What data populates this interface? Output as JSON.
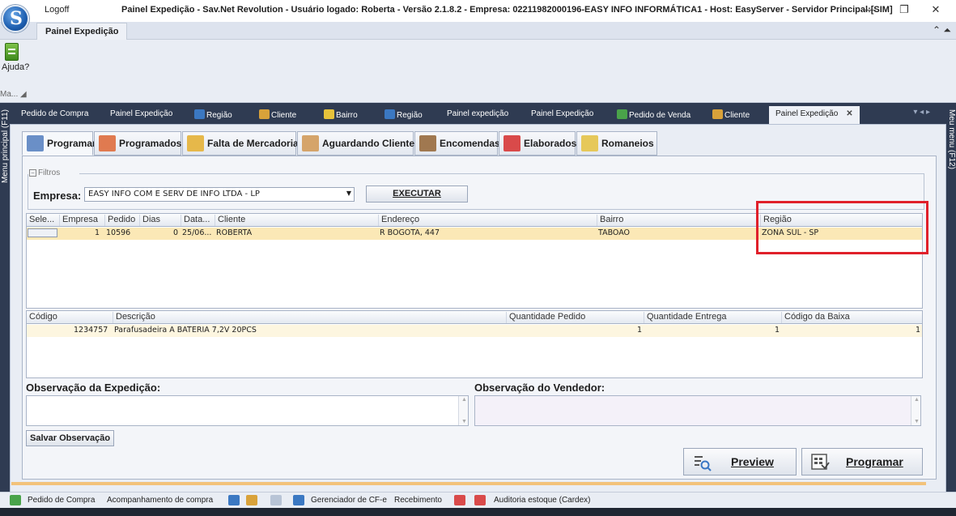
{
  "window": {
    "logoff": "Logoff",
    "title": "Painel Expedição - Sav.Net Revolution - Usuário logado: Roberta - Versão 2.1.8.2 - Empresa: 02211982000196-EASY INFO INFORMÁTICA1 - Host: EasyServer - Servidor Principal:[SIM]",
    "minimize": "—",
    "maximize": "❐",
    "close": "✕"
  },
  "ribbon": {
    "tab": "Painel Expedição",
    "right_icons": "⌃ ⏶",
    "help_label": "Ajuda?",
    "group_label": "Ma... ◢"
  },
  "side": {
    "left": "Menu principal (F11)",
    "right": "Meu menu (F12)"
  },
  "doc_tabs": [
    {
      "label": "Pedido de Compra",
      "icon": "none"
    },
    {
      "label": "Painel Expedição",
      "icon": "none"
    },
    {
      "label": "Região",
      "icon": "region-icon"
    },
    {
      "label": "Cliente",
      "icon": "client-icon"
    },
    {
      "label": "Bairro",
      "icon": "bairro-icon"
    },
    {
      "label": "Região",
      "icon": "region-icon"
    },
    {
      "label": "Painel expedição",
      "icon": "none"
    },
    {
      "label": "Painel Expedição",
      "icon": "none"
    },
    {
      "label": "Pedido de Venda",
      "icon": "order-icon"
    },
    {
      "label": "Cliente",
      "icon": "client-icon"
    },
    {
      "label": "Painel Expedição",
      "icon": "none",
      "active": true
    }
  ],
  "doc_tabs_close": "✕",
  "doc_tabs_nav": "▾  ◂  ▸",
  "inner_tabs": [
    {
      "label": "Programar",
      "active": true
    },
    {
      "label": "Programados"
    },
    {
      "label": "Falta de Mercadoria"
    },
    {
      "label": "Aguardando Cliente"
    },
    {
      "label": "Encomendas"
    },
    {
      "label": "Elaborados"
    },
    {
      "label": "Romaneios"
    }
  ],
  "filtros": {
    "legend": "Filtros",
    "toggle": "−",
    "empresa_label": "Empresa:",
    "empresa_value": "EASY INFO COM E SERV DE INFO LTDA - LP",
    "executar": "EXECUTAR"
  },
  "orders_grid": {
    "columns": [
      "Sele...",
      "Empresa",
      "Pedido",
      "Dias",
      "Data...",
      "Cliente",
      "Endereço",
      "Bairro",
      "Região"
    ],
    "rows": [
      {
        "empresa": "1",
        "pedido": "10596",
        "dias": "0",
        "data": "25/06...",
        "cliente": "ROBERTA",
        "endereco": "R BOGOTA, 447",
        "bairro": "TABOAO",
        "regiao": "ZONA SUL - SP"
      }
    ]
  },
  "items_grid": {
    "columns": [
      "Código",
      "Descrição",
      "Quantidade Pedido",
      "Quantidade Entrega",
      "Código da Baixa"
    ],
    "rows": [
      {
        "codigo": "1234757",
        "descricao": "Parafusadeira A BATERIA 7,2V 20PCS",
        "qtd_pedido": "1",
        "qtd_entrega": "1",
        "cod_baixa": "1"
      }
    ]
  },
  "observacoes": {
    "expedicao_label": "Observação da Expedição:",
    "vendedor_label": "Observação do Vendedor:",
    "salvar": "Salvar Observação"
  },
  "actions": {
    "preview": "Preview",
    "programar": "Programar"
  },
  "statusbar": [
    {
      "label": "Pedido de Compra"
    },
    {
      "label": "Acompanhamento de compra"
    },
    {
      "label": "Gerenciador de CF-e"
    },
    {
      "label": "Recebimento"
    },
    {
      "label": "Auditoria estoque (Cardex)"
    }
  ],
  "colors": {
    "selected_row": "#fbe8b6",
    "highlight_box": "#e0202a",
    "dark_strip": "#2f3b52"
  }
}
